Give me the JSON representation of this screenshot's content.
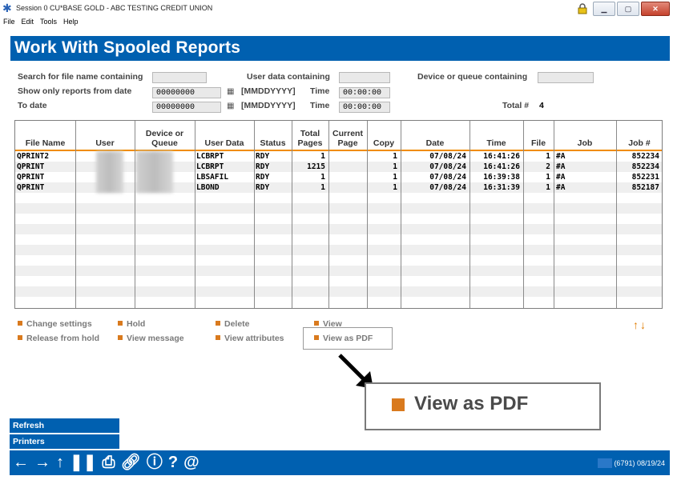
{
  "window": {
    "title": "Session 0 CU*BASE GOLD - ABC TESTING CREDIT UNION"
  },
  "menu": [
    "File",
    "Edit",
    "Tools",
    "Help"
  ],
  "page_title": "Work With Spooled Reports",
  "filters": {
    "file_name_label": "Search for file name containing",
    "file_name_value": "",
    "user_data_label": "User data containing",
    "user_data_value": "",
    "device_label": "Device or queue containing",
    "device_value": "",
    "from_label": "Show only reports from date",
    "from_value": "00000000",
    "to_label": "To date",
    "to_value": "00000000",
    "date_format": "[MMDDYYYY]",
    "time_label": "Time",
    "from_time": "00:00:00",
    "to_time": "00:00:00",
    "total_label": "Total #",
    "total_value": "4"
  },
  "table": {
    "columns": [
      "File Name",
      "User",
      "Device or Queue",
      "User Data",
      "Status",
      "Total Pages",
      "Current Page",
      "Copy",
      "Date",
      "Time",
      "File",
      "Job",
      "Job #"
    ],
    "rows": [
      {
        "file_name": "QPRINT2",
        "user_data": "LCBRPT",
        "status": "RDY",
        "total_pages": "1",
        "current_page": "",
        "copy": "1",
        "date": "07/08/24",
        "time": "16:41:26",
        "file": "1",
        "job": "#A",
        "job_no": "852234"
      },
      {
        "file_name": "QPRINT",
        "user_data": "LCBRPT",
        "status": "RDY",
        "total_pages": "1215",
        "current_page": "",
        "copy": "1",
        "date": "07/08/24",
        "time": "16:41:26",
        "file": "2",
        "job": "#A",
        "job_no": "852234"
      },
      {
        "file_name": "QPRINT",
        "user_data": "LBSAFIL",
        "status": "RDY",
        "total_pages": "1",
        "current_page": "",
        "copy": "1",
        "date": "07/08/24",
        "time": "16:39:38",
        "file": "1",
        "job": "#A",
        "job_no": "852231"
      },
      {
        "file_name": "QPRINT",
        "user_data": "LBOND",
        "status": "RDY",
        "total_pages": "1",
        "current_page": "",
        "copy": "1",
        "date": "07/08/24",
        "time": "16:31:39",
        "file": "1",
        "job": "#A",
        "job_no": "852187"
      }
    ]
  },
  "commands": {
    "change_settings": "Change settings",
    "hold": "Hold",
    "delete": "Delete",
    "view": "View",
    "release": "Release from hold",
    "view_message": "View message",
    "view_attributes": "View attributes",
    "view_pdf": "View as PDF"
  },
  "callout": {
    "text": "View as PDF"
  },
  "side_buttons": {
    "refresh": "Refresh",
    "printers": "Printers"
  },
  "footer": {
    "status": "(6791) 08/19/24"
  },
  "colors": {
    "brand_blue": "#0060b0",
    "accent_orange": "#d97a1e"
  }
}
